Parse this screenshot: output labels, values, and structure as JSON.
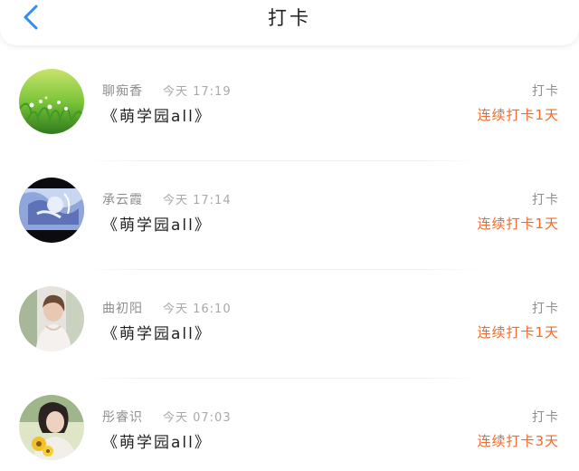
{
  "header": {
    "title": "打卡",
    "back_icon": "chevron-left-icon",
    "accent_color": "#2f8ef3"
  },
  "rows": [
    {
      "name": "聊痴香",
      "time": "今天 17:19",
      "course": "《萌学园all》",
      "action": "打卡",
      "streak": "连续打卡1天",
      "avatar": "grass-photo"
    },
    {
      "name": "承云霞",
      "time": "今天 17:14",
      "course": "《萌学园all》",
      "action": "打卡",
      "streak": "连续打卡1天",
      "avatar": "anime-photo"
    },
    {
      "name": "曲初阳",
      "time": "今天 16:10",
      "course": "《萌学园all》",
      "action": "打卡",
      "streak": "连续打卡1天",
      "avatar": "portrait-photo"
    },
    {
      "name": "彤睿识",
      "time": "今天 07:03",
      "course": "《萌学园all》",
      "action": "打卡",
      "streak": "连续打卡3天",
      "avatar": "flower-photo"
    }
  ],
  "colors": {
    "streak": "#f26a2a",
    "muted_text": "#8e8e8e"
  }
}
